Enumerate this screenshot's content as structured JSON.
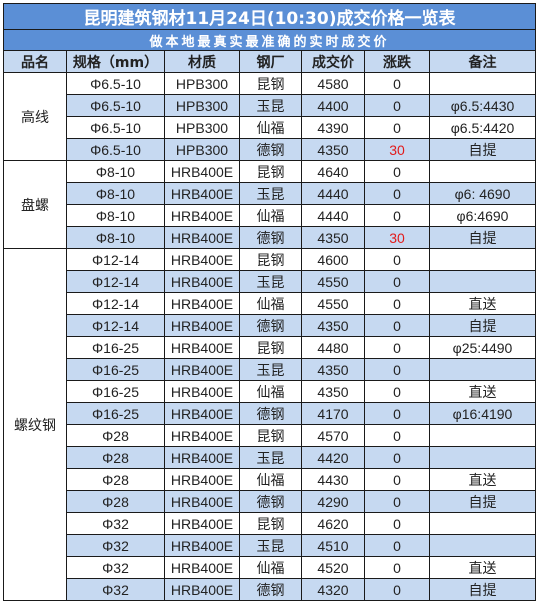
{
  "title": "昆明建筑钢材11月24日(10:30)成交价格一览表",
  "subtitle": "做本地最真实最准确的实时成交价",
  "columns": [
    "品名",
    "规格（mm）",
    "材质",
    "钢厂",
    "成交价",
    "涨跌",
    "备注"
  ],
  "colors": {
    "header_blue": "#5b8fd6",
    "row_alt_blue": "#c6d9f1",
    "rise_red": "#e21b1b"
  },
  "groups": [
    {
      "name": "高线",
      "rows": [
        {
          "spec": "Φ6.5-10",
          "grade": "HPB300",
          "mill": "昆钢",
          "price": "4580",
          "change": "0",
          "note": ""
        },
        {
          "spec": "Φ6.5-10",
          "grade": "HPB300",
          "mill": "玉昆",
          "price": "4400",
          "change": "0",
          "note": "φ6.5:4430"
        },
        {
          "spec": "Φ6.5-10",
          "grade": "HPB300",
          "mill": "仙福",
          "price": "4390",
          "change": "0",
          "note": "φ6.5:4420"
        },
        {
          "spec": "Φ6.5-10",
          "grade": "HPB300",
          "mill": "德钢",
          "price": "4350",
          "change": "30",
          "note": "自提"
        }
      ]
    },
    {
      "name": "盘螺",
      "rows": [
        {
          "spec": "Φ8-10",
          "grade": "HRB400E",
          "mill": "昆钢",
          "price": "4640",
          "change": "0",
          "note": ""
        },
        {
          "spec": "Φ8-10",
          "grade": "HRB400E",
          "mill": "玉昆",
          "price": "4440",
          "change": "0",
          "note": "φ6: 4690"
        },
        {
          "spec": "Φ8-10",
          "grade": "HRB400E",
          "mill": "仙福",
          "price": "4440",
          "change": "0",
          "note": "φ6:4690"
        },
        {
          "spec": "Φ8-10",
          "grade": "HRB400E",
          "mill": "德钢",
          "price": "4350",
          "change": "30",
          "note": "自提"
        }
      ]
    },
    {
      "name": "螺纹钢",
      "rows": [
        {
          "spec": "Φ12-14",
          "grade": "HRB400E",
          "mill": "昆钢",
          "price": "4600",
          "change": "0",
          "note": ""
        },
        {
          "spec": "Φ12-14",
          "grade": "HRB400E",
          "mill": "玉昆",
          "price": "4550",
          "change": "0",
          "note": ""
        },
        {
          "spec": "Φ12-14",
          "grade": "HRB400E",
          "mill": "仙福",
          "price": "4550",
          "change": "0",
          "note": "直送"
        },
        {
          "spec": "Φ12-14",
          "grade": "HRB400E",
          "mill": "德钢",
          "price": "4350",
          "change": "0",
          "note": "自提"
        },
        {
          "spec": "Φ16-25",
          "grade": "HRB400E",
          "mill": "昆钢",
          "price": "4480",
          "change": "0",
          "note": "φ25:4490"
        },
        {
          "spec": "Φ16-25",
          "grade": "HRB400E",
          "mill": "玉昆",
          "price": "4350",
          "change": "0",
          "note": ""
        },
        {
          "spec": "Φ16-25",
          "grade": "HRB400E",
          "mill": "仙福",
          "price": "4350",
          "change": "0",
          "note": "直送"
        },
        {
          "spec": "Φ16-25",
          "grade": "HRB400E",
          "mill": "德钢",
          "price": "4170",
          "change": "0",
          "note": "φ16:4190"
        },
        {
          "spec": "Φ28",
          "grade": "HRB400E",
          "mill": "昆钢",
          "price": "4570",
          "change": "0",
          "note": ""
        },
        {
          "spec": "Φ28",
          "grade": "HRB400E",
          "mill": "玉昆",
          "price": "4420",
          "change": "0",
          "note": ""
        },
        {
          "spec": "Φ28",
          "grade": "HRB400E",
          "mill": "仙福",
          "price": "4430",
          "change": "0",
          "note": "直送"
        },
        {
          "spec": "Φ28",
          "grade": "HRB400E",
          "mill": "德钢",
          "price": "4290",
          "change": "0",
          "note": "自提"
        },
        {
          "spec": "Φ32",
          "grade": "HRB400E",
          "mill": "昆钢",
          "price": "4620",
          "change": "0",
          "note": ""
        },
        {
          "spec": "Φ32",
          "grade": "HRB400E",
          "mill": "玉昆",
          "price": "4510",
          "change": "0",
          "note": ""
        },
        {
          "spec": "Φ32",
          "grade": "HRB400E",
          "mill": "仙福",
          "price": "4520",
          "change": "0",
          "note": "直送"
        },
        {
          "spec": "Φ32",
          "grade": "HRB400E",
          "mill": "德钢",
          "price": "4320",
          "change": "0",
          "note": "自提"
        }
      ]
    }
  ]
}
